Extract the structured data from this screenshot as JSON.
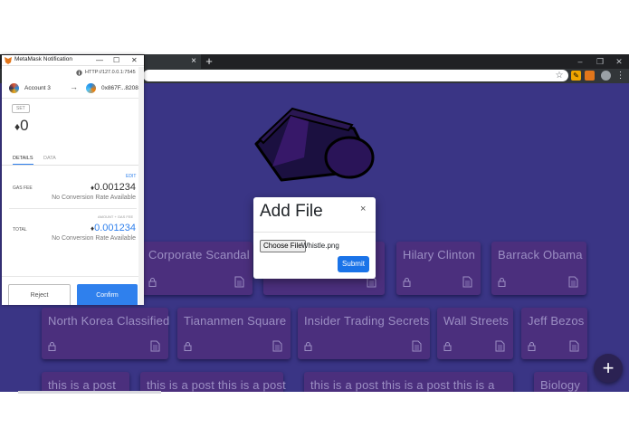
{
  "browser": {
    "new_tab": "+",
    "close_tab": "×",
    "window_controls": [
      "–",
      "❐",
      "✕"
    ],
    "bookmark_icon": "star-icon",
    "extensions": [
      "key-icon",
      "metamask-fox-icon",
      "profile-icon",
      "menu-icon"
    ]
  },
  "metamask": {
    "window_title": "MetaMask Notification",
    "window_controls": [
      "—",
      "☐",
      "✕"
    ],
    "origin": "HTTP://127.0.0.1:7545",
    "from_account": "Account 3",
    "to_address": "0x867F...8208",
    "set_label": "SET",
    "amount": "0",
    "tabs": [
      "DETAILS",
      "DATA"
    ],
    "edit_label": "EDIT",
    "gas_fee_label": "GAS FEE",
    "gas_fee_value": "0.001234",
    "gas_fee_note": "No Conversion Rate Available",
    "amount_gas_label": "AMOUNT + GAS FEE",
    "total_label": "TOTAL",
    "total_value": "0.001234",
    "total_note": "No Conversion Rate Available",
    "reject_label": "Reject",
    "confirm_label": "Confirm",
    "eth_symbol": "♦"
  },
  "modal": {
    "title": "Add File",
    "close": "×",
    "choose_file_label": "Choose File",
    "file_name": "Whistle.png",
    "submit_label": "Submit"
  },
  "cards": [
    {
      "title": "Corporate Scandal"
    },
    {
      "title": ""
    },
    {
      "title": "Hilary Clinton"
    },
    {
      "title": "Barrack Obama"
    },
    {
      "title": "North Korea Classified"
    },
    {
      "title": "Tiananmen Square"
    },
    {
      "title": "Insider Trading Secrets"
    },
    {
      "title": "Wall Streets"
    },
    {
      "title": "Jeff Bezos"
    },
    {
      "title": "this is a post"
    },
    {
      "title": "this is a post this is a post"
    },
    {
      "title": "this is a post this is a post this is a"
    },
    {
      "title": "Biology"
    }
  ],
  "fab": {
    "label": "+"
  },
  "colors": {
    "page_bg": "#3a3585",
    "card_bg": "#4b2f7d",
    "card_text": "#9c8fc4",
    "accent_blue": "#2f80ed",
    "chrome_dark": "#202124"
  }
}
